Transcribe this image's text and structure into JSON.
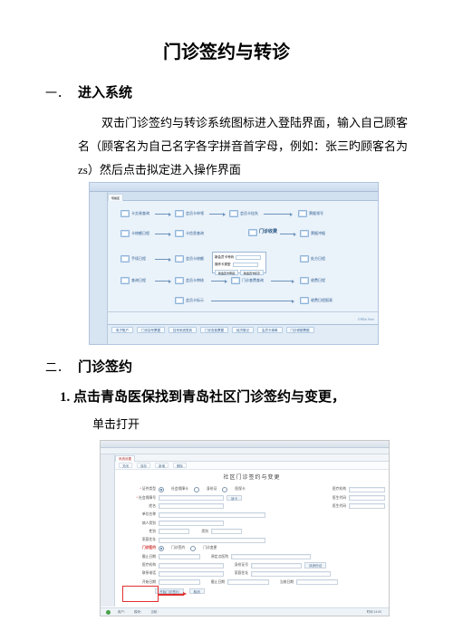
{
  "doc": {
    "title": "门诊签约与转诊",
    "section1": {
      "num": "一．",
      "heading": "进入系统",
      "body": "双击门诊签约与转诊系统图标进入登陆界面，输入自己顾客名（顾客名为自己名字各字拼音首字母，例如：张三旳顾客名为 zs）然后点击拟定进入操作界面"
    },
    "section2": {
      "num": "二．",
      "heading": "门诊签约",
      "item1": "1. 点击青岛医保找到青岛社区门诊签约与变更，",
      "item1b": "单击打开"
    }
  },
  "s1": {
    "tab1": "导航区",
    "ribbon": "门诊-取药",
    "nodes": {
      "n1": "卡交易查询",
      "n2": "会员卡申领",
      "n3": "会员卡挂失",
      "n4": "票据领号",
      "n5": "卡修额日程",
      "n6": "卡信息查询",
      "n7": "门诊收费",
      "n8": "票据冲据",
      "n9": "手续日程",
      "n10": "会员卡修额",
      "n11": "处方日程",
      "n12": "查询日程",
      "n13": "会员卡审核",
      "n14": "门诊查费查询",
      "n15": "收费日程",
      "n16": "会员卡标示",
      "n17": "收费日程报表"
    },
    "popup": {
      "lab1": "新会员卡号码",
      "lab2": "操作卡类型",
      "btn1": "新会员卡申领",
      "btn2": "新会员卡标示"
    },
    "footer": {
      "b1": "电子账户",
      "b2": "门诊挂号票据",
      "b3": "挂号系统签到",
      "b4": "门诊查费票据",
      "b5": "经济登记",
      "b6": "会员卡清单",
      "b7": "门诊修额票据"
    },
    "copyright": "ERBA Tech"
  },
  "s2": {
    "tab": "系统设置",
    "toolbar": {
      "b1": "关闭",
      "b2": "保存",
      "b3": "新增",
      "b4": "删除"
    },
    "formtitle": "社区门诊签约与变更",
    "labs": {
      "type": "证件类型",
      "id": "社会保障号",
      "name": "姓名",
      "unit": "单位名称",
      "ptype": "病人类别",
      "sex": "性别",
      "category": "类别",
      "addr": "家庭住址",
      "exp": "截止日期",
      "orig": "原定点医院",
      "inst": "医疗机构",
      "idno": "身份证号",
      "phone": "联系电话",
      "start": "开始日期",
      "curr": "当前日期"
    },
    "radios": {
      "r1": "社会保障卡",
      "r2": "身份证",
      "r3": "医保卡"
    },
    "opts": {
      "o1": "门诊签约",
      "o2": "门诊变更"
    },
    "btns": {
      "read": "读卡",
      "read2": "读身份证",
      "apply": "开始门诊签约",
      "cancel": "取消"
    },
    "rcol": {
      "l1": "医疗机构",
      "l2": "医生代码",
      "l3": "医生代码"
    },
    "status": {
      "u": "用户：",
      "o": "模块：",
      "d": "当前：",
      "t": "时间 14:00"
    }
  }
}
